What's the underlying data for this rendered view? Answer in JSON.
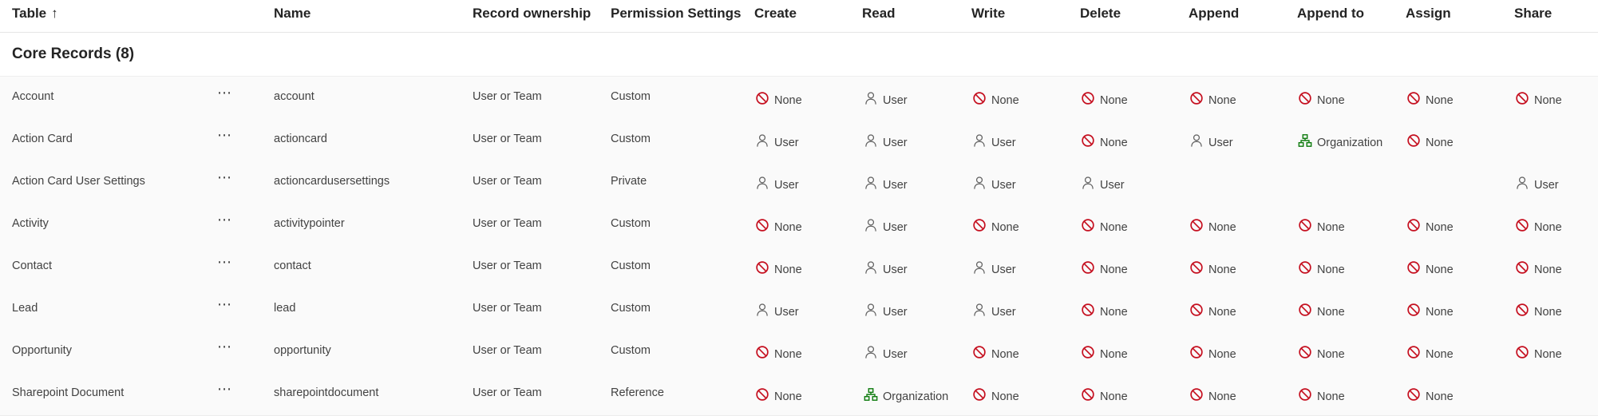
{
  "header": {
    "table": "Table",
    "sort_arrow": "↑",
    "name": "Name",
    "record_ownership": "Record ownership",
    "permission_settings": "Permission Settings",
    "create": "Create",
    "read": "Read",
    "write": "Write",
    "delete": "Delete",
    "append": "Append",
    "append_to": "Append to",
    "assign": "Assign",
    "share": "Share"
  },
  "group": {
    "title": "Core Records (8)"
  },
  "more_icon": "⋯",
  "permission_levels": {
    "none": {
      "label": "None",
      "icon": "prohibited-icon",
      "color": "#c50f1f"
    },
    "user": {
      "label": "User",
      "icon": "person-icon",
      "color": "#616161"
    },
    "organization": {
      "label": "Organization",
      "icon": "org-icon",
      "color": "#107c10"
    }
  },
  "rows": [
    {
      "table": "Account",
      "name": "account",
      "ownership": "User or Team",
      "settings": "Custom",
      "create": "None",
      "read": "User",
      "write": "None",
      "delete": "None",
      "append": "None",
      "append_to": "None",
      "assign": "None",
      "share": "None"
    },
    {
      "table": "Action Card",
      "name": "actioncard",
      "ownership": "User or Team",
      "settings": "Custom",
      "create": "User",
      "read": "User",
      "write": "User",
      "delete": "None",
      "append": "User",
      "append_to": "Organization",
      "assign": "None",
      "share": ""
    },
    {
      "table": "Action Card User Settings",
      "name": "actioncardusersettings",
      "ownership": "User or Team",
      "settings": "Private",
      "create": "User",
      "read": "User",
      "write": "User",
      "delete": "User",
      "append": "",
      "append_to": "",
      "assign": "",
      "share": "User"
    },
    {
      "table": "Activity",
      "name": "activitypointer",
      "ownership": "User or Team",
      "settings": "Custom",
      "create": "None",
      "read": "User",
      "write": "None",
      "delete": "None",
      "append": "None",
      "append_to": "None",
      "assign": "None",
      "share": "None"
    },
    {
      "table": "Contact",
      "name": "contact",
      "ownership": "User or Team",
      "settings": "Custom",
      "create": "None",
      "read": "User",
      "write": "User",
      "delete": "None",
      "append": "None",
      "append_to": "None",
      "assign": "None",
      "share": "None"
    },
    {
      "table": "Lead",
      "name": "lead",
      "ownership": "User or Team",
      "settings": "Custom",
      "create": "User",
      "read": "User",
      "write": "User",
      "delete": "None",
      "append": "None",
      "append_to": "None",
      "assign": "None",
      "share": "None"
    },
    {
      "table": "Opportunity",
      "name": "opportunity",
      "ownership": "User or Team",
      "settings": "Custom",
      "create": "None",
      "read": "User",
      "write": "None",
      "delete": "None",
      "append": "None",
      "append_to": "None",
      "assign": "None",
      "share": "None"
    },
    {
      "table": "Sharepoint Document",
      "name": "sharepointdocument",
      "ownership": "User or Team",
      "settings": "Reference",
      "create": "None",
      "read": "Organization",
      "write": "None",
      "delete": "None",
      "append": "None",
      "append_to": "None",
      "assign": "None",
      "share": ""
    }
  ]
}
